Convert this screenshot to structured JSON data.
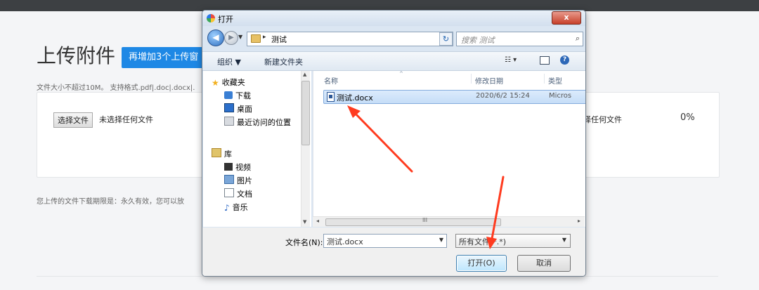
{
  "page": {
    "title": "上传附件",
    "add_button": "再增加3个上传窗",
    "description": "文件大小不超过10M。 支持格式.pdf|.doc|.docx|.",
    "file_button": "选择文件",
    "file_status": "未选择任何文件",
    "file_status_right": "择任何文件",
    "percent": "0%",
    "note": "您上传的文件下载期限是：永久有效，您可以放"
  },
  "dialog": {
    "title": "打开",
    "close": "x",
    "address": "测试",
    "search_placeholder": "搜索 测试",
    "toolbar": {
      "organize": "组织 ▼",
      "new_folder": "新建文件夹",
      "view": "☷ ▾"
    },
    "nav": {
      "favorites": "收藏夹",
      "downloads": "下载",
      "desktop": "桌面",
      "recent": "最近访问的位置",
      "libraries": "库",
      "videos": "视频",
      "pictures": "图片",
      "documents": "文档",
      "music": "音乐"
    },
    "columns": {
      "name": "名称",
      "date": "修改日期",
      "type": "类型"
    },
    "files": [
      {
        "name": "测试.docx",
        "date": "2020/6/2 15:24",
        "type": "Micros"
      }
    ],
    "filename_label": "文件名(N):",
    "filename_value": "测试.docx",
    "filetype_value": "所有文件(*.*)",
    "open_button": "打开(O)",
    "cancel_button": "取消"
  },
  "annotations": {
    "arrow_color": "#ff3b1f"
  }
}
